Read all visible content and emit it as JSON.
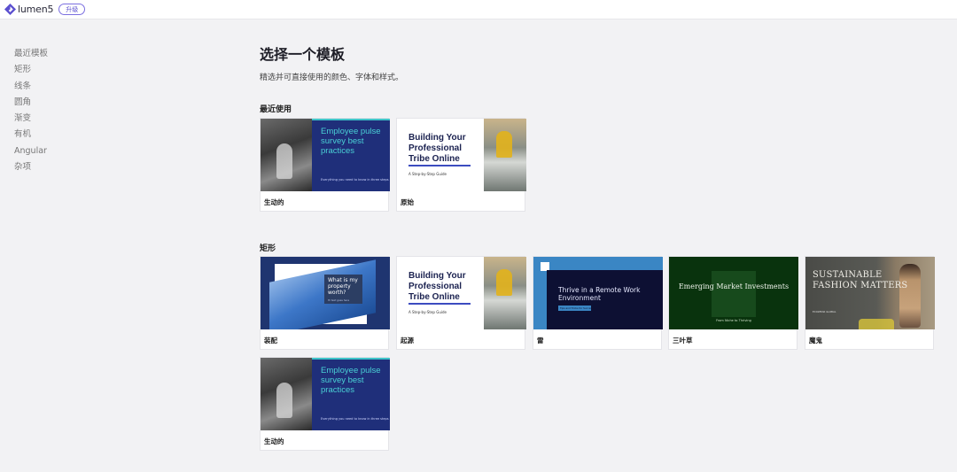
{
  "app": {
    "name": "lumen5",
    "upgrade_label": "升级",
    "brand_color": "#5b4fcf"
  },
  "sidebar": {
    "items": [
      {
        "label": "最近模板"
      },
      {
        "label": "矩形"
      },
      {
        "label": "线条"
      },
      {
        "label": "圆角"
      },
      {
        "label": "渐变"
      },
      {
        "label": "有机"
      },
      {
        "label": "Angular"
      },
      {
        "label": "杂项"
      }
    ]
  },
  "main": {
    "title": "选择一个模板",
    "subtitle": "精选并可直接使用的颜色、字体和样式。",
    "sections": [
      {
        "title": "最近使用",
        "cards": [
          {
            "label": "生动的",
            "thumb_title": "Employee pulse survey best practices",
            "thumb_sub": "Everything you need to know in three steps"
          },
          {
            "label": "原始",
            "thumb_title": "Building Your Professional Tribe Online",
            "thumb_sub": "A Step-by-Step Guide"
          }
        ]
      },
      {
        "title": "矩形",
        "cards": [
          {
            "label": "装配",
            "thumb_title": "What is my property worth?",
            "thumb_sub": "Hi text goes here"
          },
          {
            "label": "起源",
            "thumb_title": "Building Your Professional Tribe Online",
            "thumb_sub": "A Step-by-Step Guide"
          },
          {
            "label": "雷",
            "thumb_title": "Thrive in a Remote Work Environment",
            "thumb_sub": "Tips and Tricks for Success"
          },
          {
            "label": "三叶草",
            "thumb_title": "Emerging Market Investments",
            "thumb_sub": "From Niche to Thriving"
          },
          {
            "label": "魔鬼",
            "thumb_title": "SUSTAINABLE FASHION MATTERS",
            "thumb_sub": "ECOWEAR GLOBAL"
          },
          {
            "label": "生动的",
            "thumb_title": "Employee pulse survey best practices",
            "thumb_sub": "Everything you need to know in three steps"
          }
        ]
      }
    ]
  }
}
